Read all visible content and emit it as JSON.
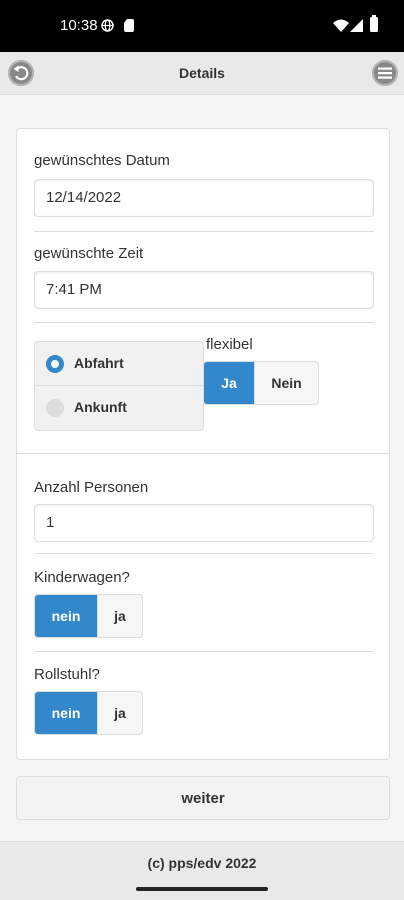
{
  "status_bar": {
    "time": "10:38",
    "icons": [
      "globe-icon",
      "sim-card-icon",
      "wifi-icon",
      "signal-icon",
      "battery-icon"
    ]
  },
  "header": {
    "title": "Details",
    "back_icon": "back-icon",
    "menu_icon": "menu-icon"
  },
  "form": {
    "date": {
      "label": "gewünschtes Datum",
      "value": "12/14/2022"
    },
    "time": {
      "label": "gewünschte Zeit",
      "value": "7:41 PM"
    },
    "direction": {
      "options": [
        "Abfahrt",
        "Ankunft"
      ],
      "selected": "Abfahrt"
    },
    "flexibel": {
      "label": "flexibel",
      "options": [
        "Ja",
        "Nein"
      ],
      "selected": "Ja"
    },
    "persons": {
      "label": "Anzahl Personen",
      "value": "1"
    },
    "kinderwagen": {
      "label": "Kinderwagen?",
      "options": [
        "nein",
        "ja"
      ],
      "selected": "nein"
    },
    "rollstuhl": {
      "label": "Rollstuhl?",
      "options": [
        "nein",
        "ja"
      ],
      "selected": "nein"
    }
  },
  "actions": {
    "next_label": "weiter"
  },
  "footer": {
    "text": "(c) pps/edv 2022"
  },
  "colors": {
    "accent": "#3388cc",
    "header_bg": "#e9e9e9",
    "page_bg": "#f5f5f5"
  }
}
